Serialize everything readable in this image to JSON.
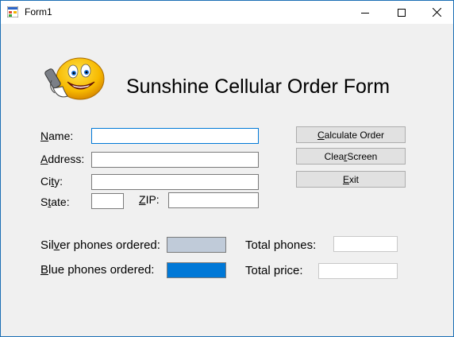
{
  "window": {
    "title": "Form1"
  },
  "heading": "Sunshine Cellular Order Form",
  "labels": {
    "name": {
      "access_key": "N",
      "rest": "ame:"
    },
    "address": {
      "access_key": "A",
      "rest": "ddress:"
    },
    "city": {
      "pre": "Ci",
      "access_key": "t",
      "rest": "y:"
    },
    "state": {
      "pre": "S",
      "access_key": "t",
      "rest": "ate:"
    },
    "zip": {
      "access_key": "Z",
      "rest": "IP:"
    },
    "silver": {
      "pre": "Sil",
      "access_key": "v",
      "rest": "er phones ordered:"
    },
    "blue": {
      "access_key": "B",
      "rest": "lue phones ordered:"
    },
    "total_phones": "Total phones:",
    "total_price": "Total price:"
  },
  "fields": {
    "name": "",
    "address": "",
    "city": "",
    "state": "",
    "zip": "",
    "total_phones": "",
    "total_price": ""
  },
  "buttons": {
    "calculate": {
      "access_key": "C",
      "rest": "alculate Order"
    },
    "clear": {
      "pre": "Clea",
      "access_key": "r",
      "rest": " Screen"
    },
    "exit": {
      "access_key": "E",
      "rest": "xit"
    }
  },
  "colors": {
    "silver_swatch": "#c0cbd9",
    "blue_swatch": "#0078d7",
    "window_border": "#1c6fb5"
  },
  "icons": [
    "form-app-icon",
    "minimize-icon",
    "maximize-icon",
    "close-icon",
    "smiley-phone-icon"
  ]
}
